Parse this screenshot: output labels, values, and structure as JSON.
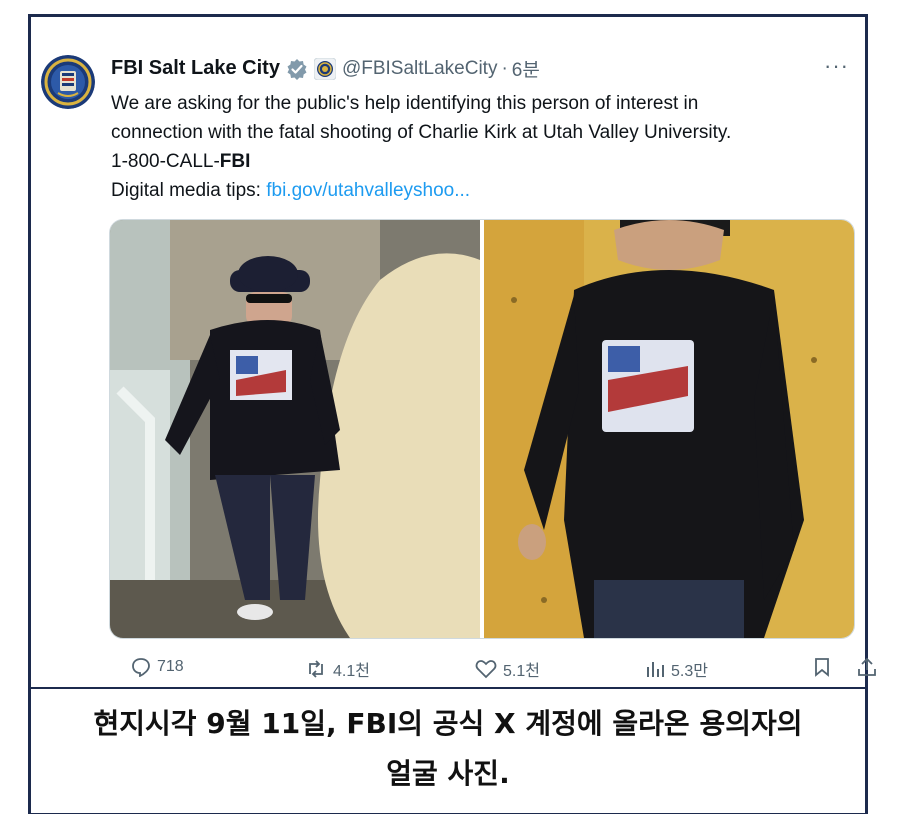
{
  "tweet": {
    "display_name": "FBI Salt Lake City",
    "handle": "@FBISaltLakeCity",
    "separator": "·",
    "time": "6분",
    "more": "···",
    "text_line1": "We are asking for the public's help identifying this person of interest in",
    "text_line2": "connection with the fatal shooting of Charlie Kirk at Utah Valley University.",
    "phone_prefix": "1-800-CALL-",
    "phone_bold": "FBI",
    "tips_label": "Digital media tips: ",
    "tips_link": "fbi.gov/utahvalleyshoo...",
    "colors": {
      "link": "#1d9bf0",
      "muted": "#536471",
      "verified": "#829aab",
      "frame": "#1c2a4d"
    }
  },
  "actions": {
    "replies": "718",
    "reposts": "4.1천",
    "likes": "5.1천",
    "views": "5.3만"
  },
  "caption": {
    "line1": "현지시각 9월 11일, FBI의 공식 X 계정에 올라온 용의자의",
    "line2": "얼굴 사진."
  }
}
